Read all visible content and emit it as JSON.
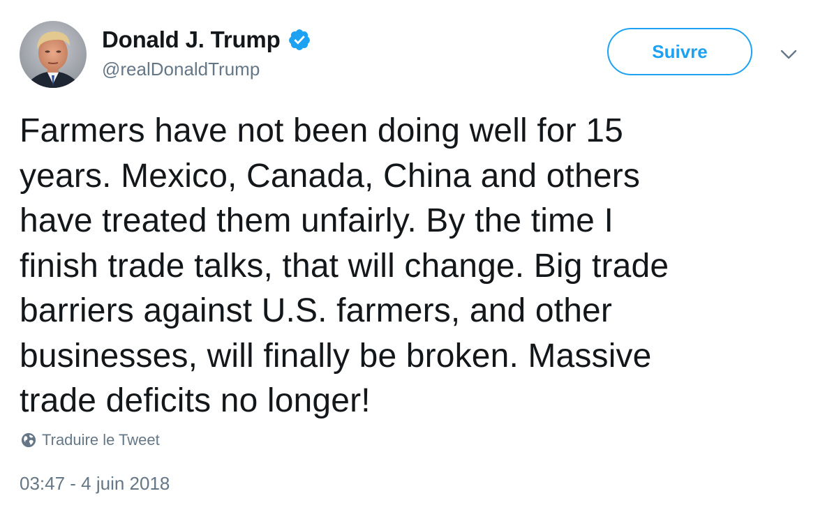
{
  "author": {
    "display_name": "Donald J. Trump",
    "handle": "@realDonaldTrump",
    "verified": true,
    "avatar_icon": "profile-photo"
  },
  "actions": {
    "follow_label": "Suivre",
    "more_icon": "chevron-down-icon"
  },
  "tweet": {
    "text": "Farmers have not been doing well for 15\nyears. Mexico, Canada, China and others\nhave treated them unfairly. By the time I\nfinish trade talks, that will change. Big trade\nbarriers against U.S. farmers, and other\nbusinesses, will finally be broken. Massive\ntrade deficits no longer!",
    "translate_label": "Traduire le Tweet",
    "timestamp": "03:47 - 4 juin 2018"
  },
  "colors": {
    "accent": "#1da1f2",
    "text": "#14171a",
    "secondary": "#657786"
  }
}
